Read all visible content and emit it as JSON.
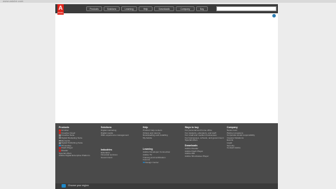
{
  "browser": {
    "url": "www.adobe.com"
  },
  "logo": {
    "mark": "A",
    "word": "Adobe"
  },
  "nav": {
    "items": [
      {
        "label": "Products"
      },
      {
        "label": "Solutions"
      },
      {
        "label": "Learning"
      },
      {
        "label": "Help"
      },
      {
        "label": "Downloads"
      },
      {
        "label": "Company"
      },
      {
        "label": "Buy"
      }
    ]
  },
  "footer": {
    "products": {
      "heading": "Products",
      "items": [
        "Acrobat",
        "Creative Cloud",
        "Creative Suite",
        "Digital Marketing Suite",
        "Elements",
        "Digital Publishing Suite",
        "Photoshop",
        "Flash Player",
        "Reader",
        "Special offers",
        "Adobe Digital Enterprise Platform"
      ]
    },
    "solutions": {
      "heading": "Solutions",
      "items": [
        "Digital marketing",
        "Digital media",
        "Web experience management"
      ]
    },
    "industries": {
      "heading": "Industries",
      "items": [
        "Education",
        "Financial services",
        "Government"
      ]
    },
    "help": {
      "heading": "Help",
      "items": [
        "Product help centers",
        "Orders and returns",
        "Downloading and installing",
        "My Adobe"
      ]
    },
    "learning": {
      "heading": "Learning",
      "items": [
        "Adobe Developer Connection",
        "Adobe TV",
        "Training and certification",
        "Forums",
        "Design Center"
      ]
    },
    "ways": {
      "heading": "Ways to buy",
      "items": [
        "For personal and home office",
        "For students, educators, and staff",
        "For small and medium businesses",
        "For businesses, schools, and government",
        "Special offers"
      ]
    },
    "downloads": {
      "heading": "Downloads",
      "items": [
        "Adobe Reader",
        "Adobe Flash Player",
        "Adobe AIR",
        "Adobe Shockwave Player"
      ]
    },
    "company": {
      "heading": "Company",
      "items": [
        "News room",
        "Partner programs",
        "Corporate social responsibility",
        "Investor Relations",
        "Events",
        "Legal",
        "Security",
        "Contact Adobe"
      ]
    }
  },
  "bottom": {
    "label": "Choose your region"
  },
  "colors": {
    "nav": "#3b3b3b",
    "footer": "#4a4a4a",
    "logo": "#e2231a",
    "accent": "#2a7ab0"
  }
}
